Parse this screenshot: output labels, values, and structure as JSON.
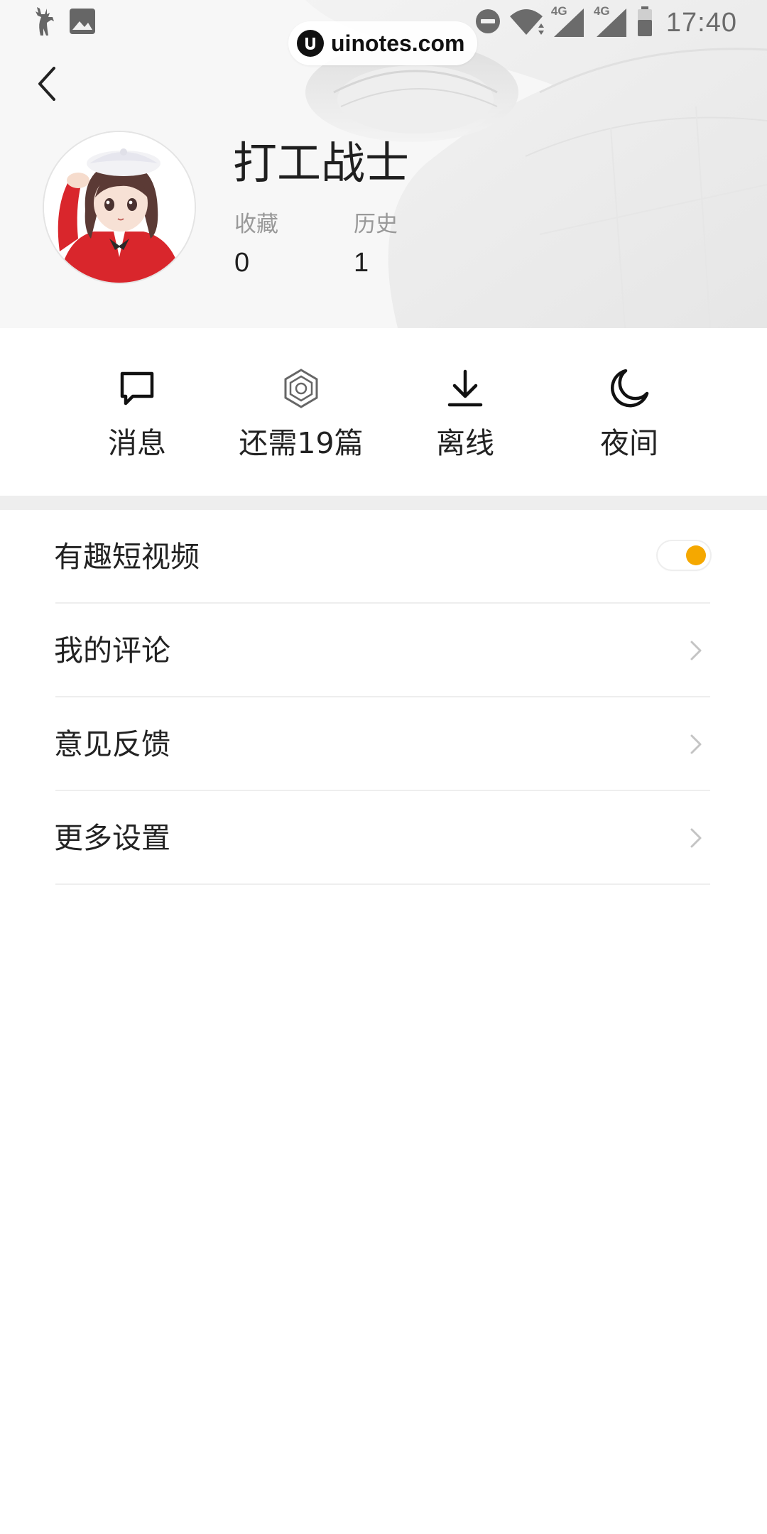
{
  "status_bar": {
    "time": "17:40",
    "network_1": "4G",
    "network_2": "4G",
    "icons": [
      "deer-icon",
      "gallery-icon",
      "do-not-disturb-icon",
      "wifi-icon",
      "signal-icon",
      "signal-icon",
      "battery-icon"
    ]
  },
  "watermark": {
    "text": "uinotes.com"
  },
  "profile": {
    "name": "打工战士",
    "stats": [
      {
        "label": "收藏",
        "value": "0"
      },
      {
        "label": "历史",
        "value": "1"
      }
    ]
  },
  "quick_actions": [
    {
      "label": "消息",
      "icon": "message-icon"
    },
    {
      "label": "还需19篇",
      "icon": "hexagon-badge-icon"
    },
    {
      "label": "离线",
      "icon": "download-icon"
    },
    {
      "label": "夜间",
      "icon": "moon-icon"
    }
  ],
  "settings": [
    {
      "label": "有趣短视频",
      "control": "toggle",
      "on": true
    },
    {
      "label": "我的评论",
      "control": "chevron"
    },
    {
      "label": "意见反馈",
      "control": "chevron"
    },
    {
      "label": "更多设置",
      "control": "chevron"
    }
  ],
  "colors": {
    "accent": "#f5a800",
    "divider": "#eeeeee",
    "muted_text": "#999999",
    "primary_text": "#222222"
  }
}
